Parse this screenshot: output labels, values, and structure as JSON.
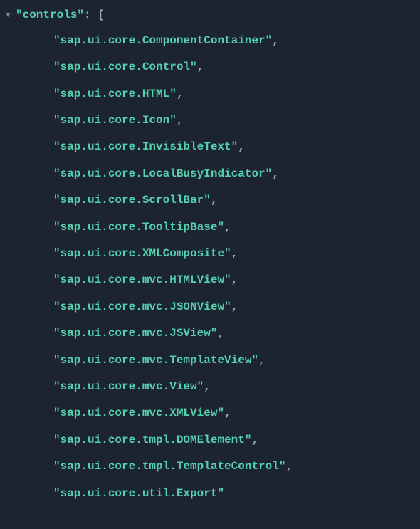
{
  "json": {
    "toggle_glyph": "▼",
    "key": "\"controls\"",
    "colon": ":",
    "space": " ",
    "bracket_open": "[",
    "items": [
      "\"sap.ui.core.ComponentContainer\"",
      "\"sap.ui.core.Control\"",
      "\"sap.ui.core.HTML\"",
      "\"sap.ui.core.Icon\"",
      "\"sap.ui.core.InvisibleText\"",
      "\"sap.ui.core.LocalBusyIndicator\"",
      "\"sap.ui.core.ScrollBar\"",
      "\"sap.ui.core.TooltipBase\"",
      "\"sap.ui.core.XMLComposite\"",
      "\"sap.ui.core.mvc.HTMLView\"",
      "\"sap.ui.core.mvc.JSONView\"",
      "\"sap.ui.core.mvc.JSView\"",
      "\"sap.ui.core.mvc.TemplateView\"",
      "\"sap.ui.core.mvc.View\"",
      "\"sap.ui.core.mvc.XMLView\"",
      "\"sap.ui.core.tmpl.DOMElement\"",
      "\"sap.ui.core.tmpl.TemplateControl\"",
      "\"sap.ui.core.util.Export\""
    ],
    "comma": ","
  }
}
